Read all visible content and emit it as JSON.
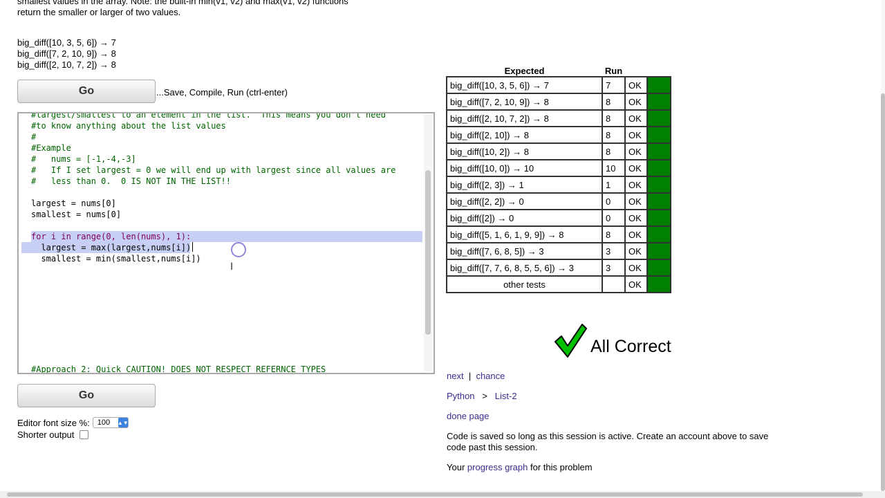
{
  "problem": {
    "description_line1": "smallest values in the array. Note: the built-in min(v1, v2) and max(v1, v2) functions",
    "description_line2": "return the smaller or larger of two values.",
    "examples": [
      "big_diff([10, 3, 5, 6]) → 7",
      "big_diff([7, 2, 10, 9]) → 8",
      "big_diff([2, 10, 7, 2]) → 8"
    ]
  },
  "toolbar": {
    "go_label": "Go",
    "go_hint": "...Save, Compile, Run (ctrl-enter)"
  },
  "editor": {
    "lines": [
      "#largest/smallest to an element in the list.  This means you don't need",
      "#to know anything about the list values",
      "#",
      "#Example",
      "#   nums = [-1,-4,-3]",
      "#   If I set largest = 0 we will end up with largest since all values are",
      "#   less than 0.  0 IS NOT IN THE LIST!!",
      "largest = nums[0]",
      "smallest = nums[0]",
      "for i in range(0, len(nums), 1):",
      "  largest = max(largest,nums[i])",
      "  smallest = min(smallest,nums[i])",
      "#Approach 2: Quick CAUTION! DOES NOT RESPECT REFERNCE TYPES"
    ]
  },
  "options": {
    "font_size_label": "Editor font size %:",
    "font_size_value": "100",
    "shorter_output_label": "Shorter output"
  },
  "results": {
    "header_expected": "Expected",
    "header_run": "Run",
    "rows": [
      {
        "expected": "big_diff([10, 3, 5, 6]) → 7",
        "run": "7",
        "status": "OK"
      },
      {
        "expected": "big_diff([7, 2, 10, 9]) → 8",
        "run": "8",
        "status": "OK"
      },
      {
        "expected": "big_diff([2, 10, 7, 2]) → 8",
        "run": "8",
        "status": "OK"
      },
      {
        "expected": "big_diff([2, 10]) → 8",
        "run": "8",
        "status": "OK"
      },
      {
        "expected": "big_diff([10, 2]) → 8",
        "run": "8",
        "status": "OK"
      },
      {
        "expected": "big_diff([10, 0]) → 10",
        "run": "10",
        "status": "OK"
      },
      {
        "expected": "big_diff([2, 3]) → 1",
        "run": "1",
        "status": "OK"
      },
      {
        "expected": "big_diff([2, 2]) → 0",
        "run": "0",
        "status": "OK"
      },
      {
        "expected": "big_diff([2]) → 0",
        "run": "0",
        "status": "OK"
      },
      {
        "expected": "big_diff([5, 1, 6, 1, 9, 9]) → 8",
        "run": "8",
        "status": "OK"
      },
      {
        "expected": "big_diff([7, 6, 8, 5]) → 3",
        "run": "3",
        "status": "OK"
      },
      {
        "expected": "big_diff([7, 7, 6, 8, 5, 5, 6]) → 3",
        "run": "3",
        "status": "OK"
      }
    ],
    "other_tests_label": "other tests",
    "other_tests_status": "OK",
    "pass_color": "#008000"
  },
  "verdict": {
    "text": "All Correct",
    "icon": "checkmark-icon"
  },
  "nav": {
    "next": "next",
    "separator": "|",
    "chance": "chance",
    "crumb_language": "Python",
    "crumb_sep": ">",
    "crumb_section": "List-2",
    "done_page": "done page",
    "save_note": "Code is saved so long as this session is active. Create an account above to save code past this session.",
    "progress_prefix": "Your",
    "progress_link": "progress graph",
    "progress_suffix": "for this problem"
  }
}
